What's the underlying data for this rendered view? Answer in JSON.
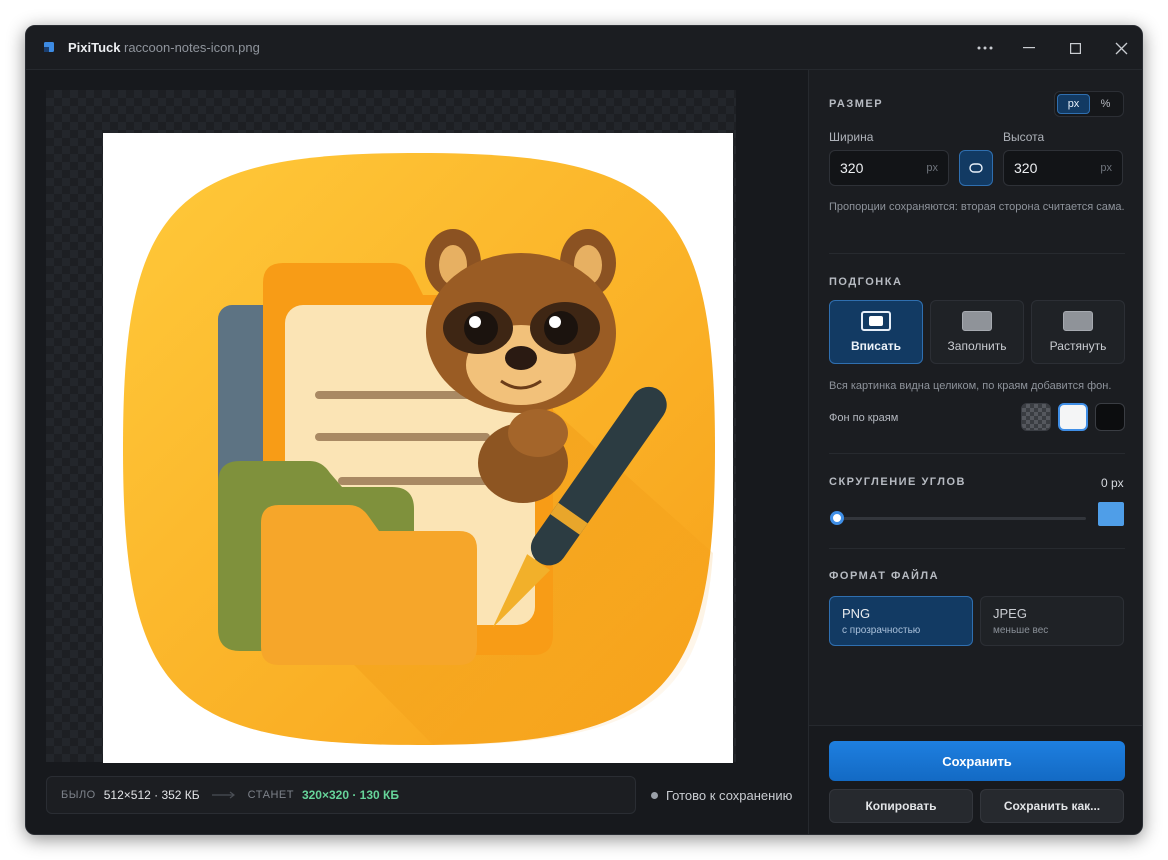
{
  "titlebar": {
    "app_name": "PixiTuck",
    "file_name": "raccoon-notes-icon.png",
    "more_icon": "more-dots-icon",
    "minimize_icon": "minimize-icon",
    "maximize_icon": "maximize-icon",
    "close_icon": "close-icon"
  },
  "info": {
    "before_label": "БЫЛО",
    "before_value": "512×512 · 352 КБ",
    "after_label": "СТАНЕТ",
    "after_value": "320×320 · 130 КБ",
    "status": "Готово к сохранению"
  },
  "size": {
    "title": "РАЗМЕР",
    "unit_px": "px",
    "unit_percent": "%",
    "width_label": "Ширина",
    "width_value": "320",
    "height_label": "Высота",
    "height_value": "320",
    "unit": "px",
    "hint": "Пропорции сохраняются: вторая сторона считается сама."
  },
  "fit": {
    "title": "ПОДГОНКА",
    "options": [
      {
        "label": "Вписать",
        "active": true
      },
      {
        "label": "Заполнить",
        "active": false
      },
      {
        "label": "Растянуть",
        "active": false
      }
    ],
    "hint": "Вся картинка видна целиком, по краям добавится фон.",
    "bg_label": "Фон по краям",
    "bg_colors": [
      "transparent",
      "#ffffff",
      "#000000"
    ]
  },
  "corner": {
    "title": "СКРУГЛЕНИЕ УГЛОВ",
    "value": "0 px",
    "level": 0,
    "color": "#4f9ee8"
  },
  "format": {
    "title": "ФОРМАТ ФАЙЛА",
    "options": [
      {
        "name": "PNG",
        "sub": "с прозрачностью",
        "active": true
      },
      {
        "name": "JPEG",
        "sub": "меньше вес",
        "active": false
      }
    ]
  },
  "actions": {
    "save": "Сохранить",
    "copy": "Копировать",
    "save_as": "Сохранить как..."
  },
  "colors": {
    "accent": "#1e7fe0",
    "selected": "#123a63",
    "success": "#66d49a"
  }
}
